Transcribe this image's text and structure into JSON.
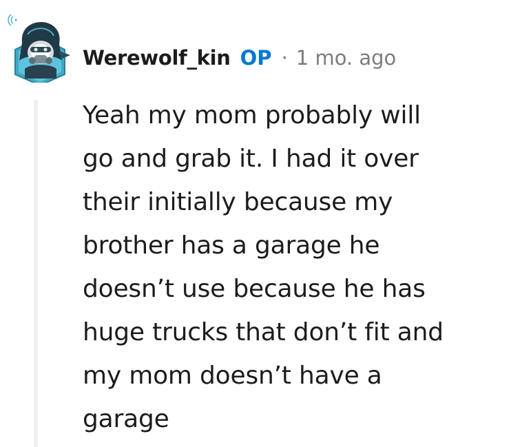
{
  "comment": {
    "author": "Werewolf_kin",
    "op_badge": "OP",
    "separator": "·",
    "timestamp": "1 mo. ago",
    "body": "Yeah my mom probably will\ngo and grab it. I had it over\ntheir initially because my\nbrother has a garage he\ndoesn’t use because he has\nhuge trucks that don’t fit and\nmy mom doesn’t have a\ngarage",
    "avatar_icon": "werewolf-avatar-icon",
    "colors": {
      "op_badge": "#0079d3",
      "timestamp": "#7c7c7c",
      "text": "#1c1c1c",
      "thread_line": "#edeff1"
    }
  }
}
